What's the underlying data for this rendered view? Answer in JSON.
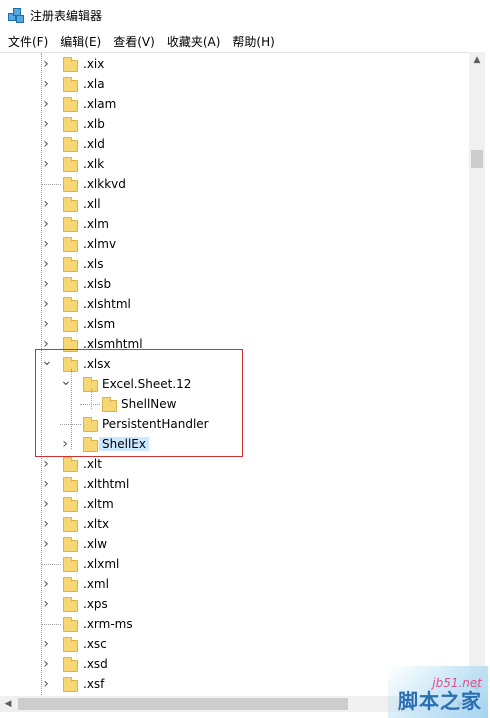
{
  "window": {
    "title": "注册表编辑器"
  },
  "menu": [
    {
      "label": "文件(F)"
    },
    {
      "label": "编辑(E)"
    },
    {
      "label": "查看(V)"
    },
    {
      "label": "收藏夹(A)"
    },
    {
      "label": "帮助(H)"
    }
  ],
  "tree": [
    {
      "label": ".xix",
      "level": 0,
      "state": "collapsed"
    },
    {
      "label": ".xla",
      "level": 0,
      "state": "collapsed"
    },
    {
      "label": ".xlam",
      "level": 0,
      "state": "collapsed"
    },
    {
      "label": ".xlb",
      "level": 0,
      "state": "collapsed"
    },
    {
      "label": ".xld",
      "level": 0,
      "state": "collapsed"
    },
    {
      "label": ".xlk",
      "level": 0,
      "state": "collapsed"
    },
    {
      "label": ".xlkkvd",
      "level": 0,
      "state": "leaf"
    },
    {
      "label": ".xll",
      "level": 0,
      "state": "collapsed"
    },
    {
      "label": ".xlm",
      "level": 0,
      "state": "collapsed"
    },
    {
      "label": ".xlmv",
      "level": 0,
      "state": "collapsed"
    },
    {
      "label": ".xls",
      "level": 0,
      "state": "collapsed"
    },
    {
      "label": ".xlsb",
      "level": 0,
      "state": "collapsed"
    },
    {
      "label": ".xlshtml",
      "level": 0,
      "state": "collapsed"
    },
    {
      "label": ".xlsm",
      "level": 0,
      "state": "collapsed"
    },
    {
      "label": ".xlsmhtml",
      "level": 0,
      "state": "collapsed"
    },
    {
      "label": ".xlsx",
      "level": 0,
      "state": "expanded"
    },
    {
      "label": "Excel.Sheet.12",
      "level": 1,
      "state": "expanded"
    },
    {
      "label": "ShellNew",
      "level": 2,
      "state": "leaf"
    },
    {
      "label": "PersistentHandler",
      "level": 1,
      "state": "leaf"
    },
    {
      "label": "ShellEx",
      "level": 1,
      "state": "collapsed",
      "selected": true
    },
    {
      "label": ".xlt",
      "level": 0,
      "state": "collapsed"
    },
    {
      "label": ".xlthtml",
      "level": 0,
      "state": "collapsed"
    },
    {
      "label": ".xltm",
      "level": 0,
      "state": "collapsed"
    },
    {
      "label": ".xltx",
      "level": 0,
      "state": "collapsed"
    },
    {
      "label": ".xlw",
      "level": 0,
      "state": "collapsed"
    },
    {
      "label": ".xlxml",
      "level": 0,
      "state": "leaf"
    },
    {
      "label": ".xml",
      "level": 0,
      "state": "collapsed"
    },
    {
      "label": ".xps",
      "level": 0,
      "state": "collapsed"
    },
    {
      "label": ".xrm-ms",
      "level": 0,
      "state": "leaf"
    },
    {
      "label": ".xsc",
      "level": 0,
      "state": "collapsed"
    },
    {
      "label": ".xsd",
      "level": 0,
      "state": "collapsed"
    },
    {
      "label": ".xsf",
      "level": 0,
      "state": "collapsed"
    }
  ],
  "watermark": {
    "domain": "jb51.net",
    "text": "脚本之家"
  },
  "colors": {
    "highlight_border": "#d03030",
    "selection": "#cce8ff",
    "folder": "#f7d774"
  }
}
